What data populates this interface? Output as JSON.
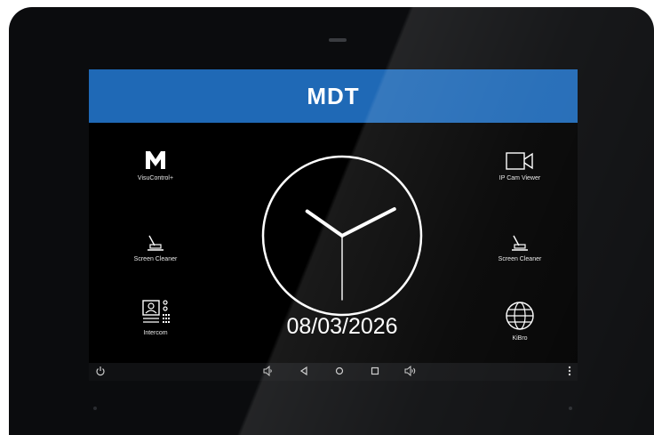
{
  "header": {
    "logo": "MDT",
    "brand_color": "#1f69b6"
  },
  "apps_left": [
    {
      "label": "VisuControl+",
      "icon": "mdt-m-icon"
    },
    {
      "label": "Screen Cleaner",
      "icon": "wiper-icon"
    },
    {
      "label": "Intercom",
      "icon": "intercom-icon"
    }
  ],
  "apps_right": [
    {
      "label": "IP Cam Viewer",
      "icon": "video-camera-icon"
    },
    {
      "label": "Screen Cleaner",
      "icon": "wiper-icon"
    },
    {
      "label": "KiBro",
      "icon": "globe-icon"
    }
  ],
  "clock": {
    "hour": 10,
    "minute": 10,
    "second": 30
  },
  "date": "08/03/2026",
  "navbar": [
    "power-icon",
    "volume-down-icon",
    "back-icon",
    "home-icon",
    "recents-icon",
    "volume-up-icon",
    "more-icon"
  ]
}
